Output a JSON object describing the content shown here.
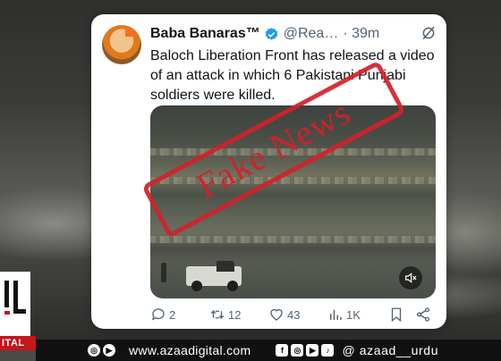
{
  "tweet": {
    "display_name": "Baba Banaras™",
    "handle": "@Rea…",
    "time": "· 39m",
    "text": "Baloch Liberation Front has released a video of an attack in which 6 Pakistani Punjabi soldiers were killed.",
    "reply_count": "2",
    "retweet_count": "12",
    "like_count": "43",
    "view_count": "1K"
  },
  "stamp": {
    "text": "Fake News",
    "color": "#d3212a"
  },
  "brand": {
    "logo_text": "ITAL",
    "accent": "#c4161c"
  },
  "footer": {
    "website": "www.azaadigital.com",
    "social_handle": "@ azaad__urdu",
    "icons_left": [
      "instagram-icon",
      "youtube-icon"
    ],
    "icons_right": [
      "facebook-icon",
      "instagram-icon",
      "youtube-icon",
      "tiktok-icon"
    ]
  },
  "colors": {
    "verified": "#1d9bf0",
    "text": "#0f1419",
    "muted": "#536471"
  }
}
